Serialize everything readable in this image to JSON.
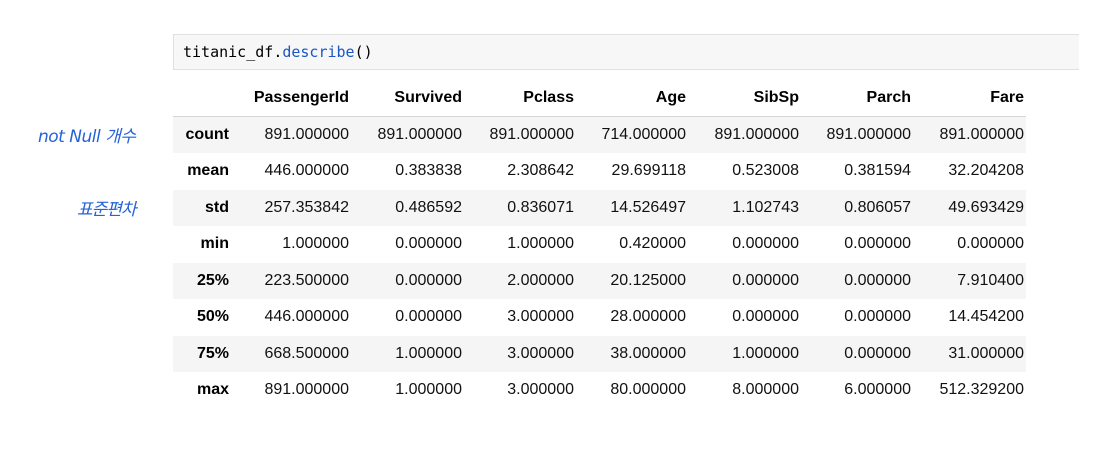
{
  "code_cell": {
    "var": "titanic_df",
    "dot": ".",
    "method": "describe",
    "parens": "()"
  },
  "annotations": {
    "count_note": "not Null 개수",
    "std_note": "표준편차"
  },
  "table": {
    "columns": [
      "",
      "PassengerId",
      "Survived",
      "Pclass",
      "Age",
      "SibSp",
      "Parch",
      "Fare"
    ],
    "rows": [
      {
        "label": "count",
        "values": [
          "891.000000",
          "891.000000",
          "891.000000",
          "714.000000",
          "891.000000",
          "891.000000",
          "891.000000"
        ]
      },
      {
        "label": "mean",
        "values": [
          "446.000000",
          "0.383838",
          "2.308642",
          "29.699118",
          "0.523008",
          "0.381594",
          "32.204208"
        ]
      },
      {
        "label": "std",
        "values": [
          "257.353842",
          "0.486592",
          "0.836071",
          "14.526497",
          "1.102743",
          "0.806057",
          "49.693429"
        ]
      },
      {
        "label": "min",
        "values": [
          "1.000000",
          "0.000000",
          "1.000000",
          "0.420000",
          "0.000000",
          "0.000000",
          "0.000000"
        ]
      },
      {
        "label": "25%",
        "values": [
          "223.500000",
          "0.000000",
          "2.000000",
          "20.125000",
          "0.000000",
          "0.000000",
          "7.910400"
        ]
      },
      {
        "label": "50%",
        "values": [
          "446.000000",
          "0.000000",
          "3.000000",
          "28.000000",
          "0.000000",
          "0.000000",
          "14.454200"
        ]
      },
      {
        "label": "75%",
        "values": [
          "668.500000",
          "1.000000",
          "3.000000",
          "38.000000",
          "1.000000",
          "0.000000",
          "31.000000"
        ]
      },
      {
        "label": "max",
        "values": [
          "891.000000",
          "1.000000",
          "3.000000",
          "80.000000",
          "8.000000",
          "6.000000",
          "512.329200"
        ]
      }
    ]
  },
  "colors": {
    "annotation": "#2563d6",
    "method": "#1a56c6",
    "row_stripe": "#f5f5f5"
  }
}
